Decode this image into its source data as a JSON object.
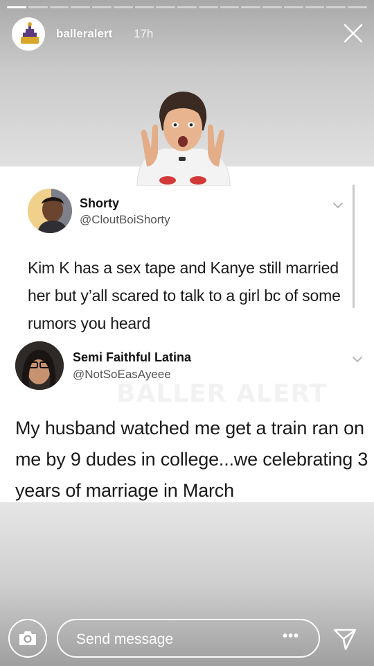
{
  "story": {
    "progress_segments": 17,
    "progress_done": 1,
    "username": "balleralert",
    "timestamp": "17h",
    "avatar_text": "BALLER ALERT"
  },
  "tweets": [
    {
      "name": "Shorty",
      "handle": "@CloutBoiShorty",
      "text": "Kim K has a sex tape and Kanye still married her but y’all scared to talk to a girl bc of some rumors you heard"
    },
    {
      "name": "Semi Faithful Latina",
      "handle": "@NotSoEasAyeee",
      "text": "My husband watched me get a train ran on me by 9 dudes in college...we celebrating 3 years of marriage in March"
    }
  ],
  "watermark": "BALLER ALERT",
  "footer": {
    "message_placeholder": "Send message",
    "more_label": "•••"
  },
  "icons": [
    "close-icon",
    "chevron-down-icon",
    "camera-icon",
    "send-icon",
    "more-icon"
  ]
}
